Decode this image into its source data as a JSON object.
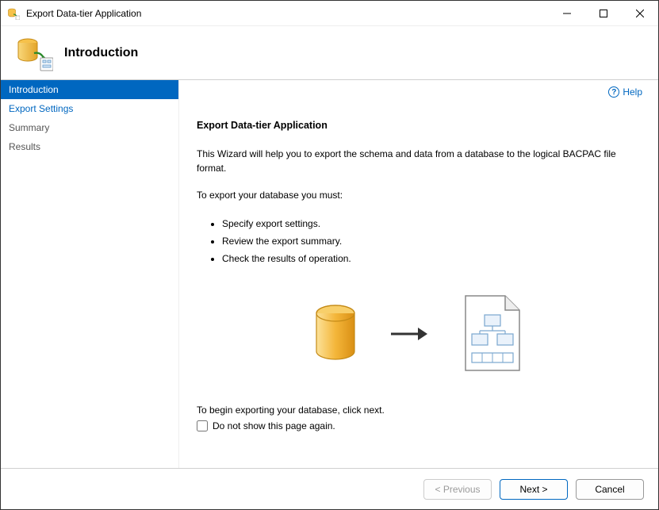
{
  "window": {
    "title": "Export Data-tier Application"
  },
  "header": {
    "title": "Introduction"
  },
  "nav": {
    "items": [
      {
        "label": "Introduction",
        "state": "active"
      },
      {
        "label": "Export Settings",
        "state": "link"
      },
      {
        "label": "Summary",
        "state": "gray"
      },
      {
        "label": "Results",
        "state": "gray"
      }
    ]
  },
  "help": {
    "label": "Help"
  },
  "main": {
    "heading": "Export Data-tier Application",
    "description": "This Wizard will help you to export the schema and data from a database to the logical BACPAC file format.",
    "lead": "To export your database you must:",
    "bullets": [
      "Specify export settings.",
      "Review the export summary.",
      "Check the results of operation."
    ],
    "begin": "To begin exporting your database, click next.",
    "checkbox_label": "Do not show this page again."
  },
  "footer": {
    "previous": "< Previous",
    "next": "Next >",
    "cancel": "Cancel"
  }
}
